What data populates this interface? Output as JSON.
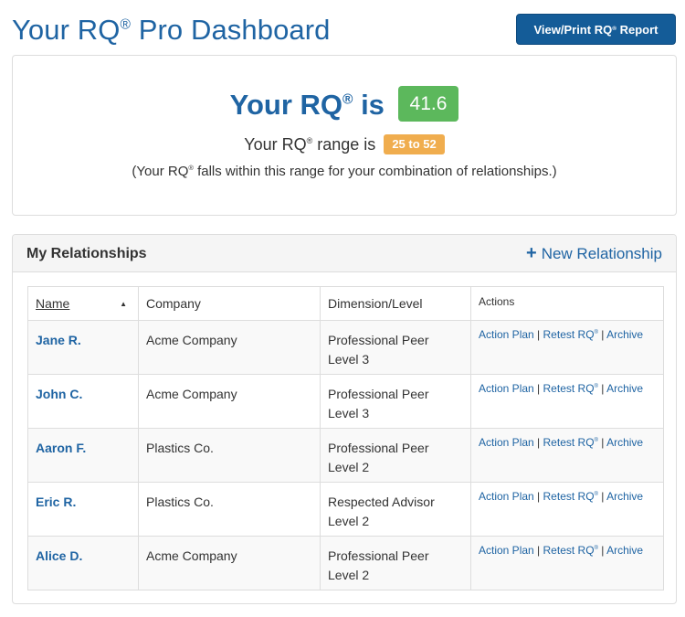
{
  "header": {
    "title_prefix": "Your RQ",
    "title_suffix": "Pro Dashboard",
    "report_button_prefix": "View/Print RQ",
    "report_button_suffix": "Report"
  },
  "reg_mark": "®",
  "summary": {
    "rq_prefix": "Your RQ",
    "rq_is": "is",
    "rq_value": "41.6",
    "range_prefix": "Your RQ",
    "range_is": "range is",
    "range_value": "25 to 52",
    "note_prefix": "(Your RQ",
    "note_suffix": "falls within this range for your combination of relationships.)"
  },
  "relationships": {
    "title": "My Relationships",
    "new_label": "New Relationship",
    "columns": {
      "name": "Name",
      "company": "Company",
      "dimension": "Dimension/Level",
      "actions": "Actions"
    },
    "actions": {
      "action_plan": "Action Plan",
      "retest": "Retest RQ",
      "archive": "Archive",
      "separator": "|"
    },
    "rows": [
      {
        "name": "Jane R.",
        "company": "Acme Company",
        "dimension": "Professional Peer",
        "level": "Level 3"
      },
      {
        "name": "John C.",
        "company": "Acme Company",
        "dimension": "Professional Peer",
        "level": "Level 3"
      },
      {
        "name": "Aaron F.",
        "company": "Plastics Co.",
        "dimension": "Professional Peer",
        "level": "Level 2"
      },
      {
        "name": "Eric R.",
        "company": "Plastics Co.",
        "dimension": "Respected Advisor",
        "level": "Level 2"
      },
      {
        "name": "Alice D.",
        "company": "Acme Company",
        "dimension": "Professional Peer",
        "level": "Level 2"
      }
    ]
  }
}
